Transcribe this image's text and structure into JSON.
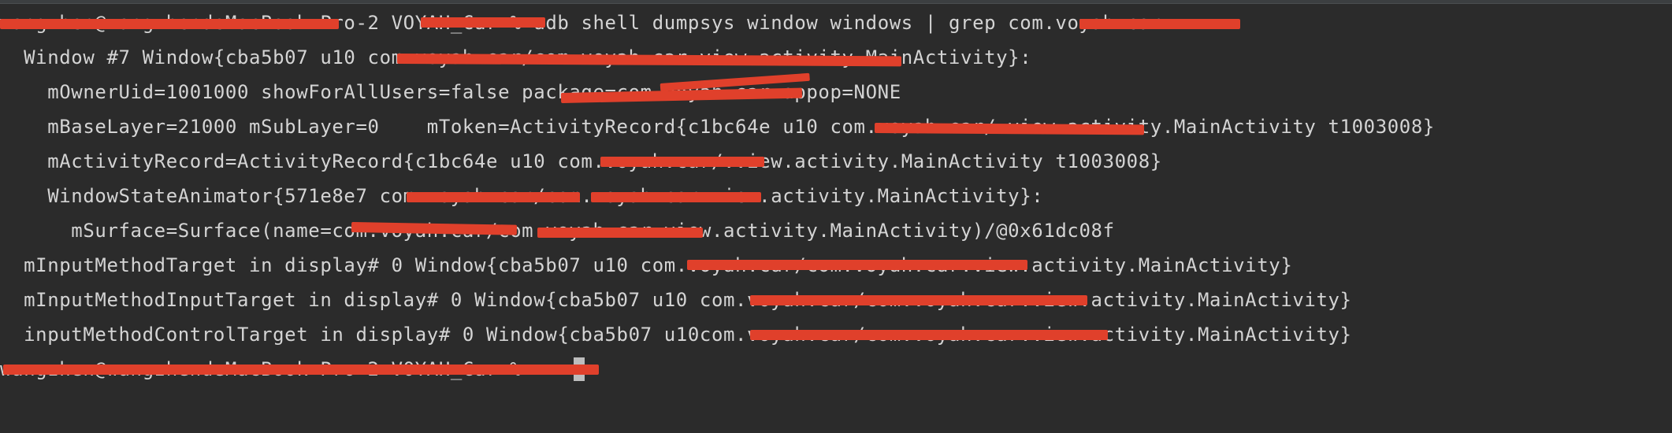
{
  "terminal": {
    "lines": [
      {
        "prefix": "wangzhen@wangzhendeMacBook-Pro-2 VOYAH_Car",
        "prompt_symbol": "%",
        "command": "adb shell dumpsys window windows | grep com.voyah.car"
      },
      {
        "text": "  Window #7 Window{cba5b07 u10 com.voyah.car/com.voyah.car.view.activity.MainActivity}:"
      },
      {
        "text": "    mOwnerUid=1001000 showForAllUsers=false package=com.voyah.car appop=NONE"
      },
      {
        "text": "    mBaseLayer=21000 mSubLayer=0    mToken=ActivityRecord{c1bc64e u10 com.voyah.car/.view.activity.MainActivity t1003008}"
      },
      {
        "text": "    mActivityRecord=ActivityRecord{c1bc64e u10 com.voyah.car/.view.activity.MainActivity t1003008}"
      },
      {
        "text": "    WindowStateAnimator{571e8e7 com.voyah.car/com.voyah.car.view.activity.MainActivity}:"
      },
      {
        "text": "      mSurface=Surface(name=com.voyah.car/com.voyah.car.view.activity.MainActivity)/@0x61dc08f"
      },
      {
        "text": "  mInputMethodTarget in display# 0 Window{cba5b07 u10 com.voyah.car/com.voyah.car.view.activity.MainActivity}"
      },
      {
        "text": "  mInputMethodInputTarget in display# 0 Window{cba5b07 u10 com.voyah.car/com.voyah.car.view.activity.MainActivity}"
      },
      {
        "text": "  inputMethodControlTarget in display# 0 Window{cba5b07 u10com.voyah.car/com.voyah.car.view.activity.MainActivity}"
      },
      {
        "prefix": "wangzhen@wangzhendeMacBook-Pro-2 VOYAH_Car",
        "prompt_symbol": "%",
        "command": ""
      }
    ],
    "colors": {
      "background": "#2b2b2b",
      "text": "#d4d4d4",
      "redaction": "#e0402b",
      "cursor": "#bdbdbd"
    }
  }
}
